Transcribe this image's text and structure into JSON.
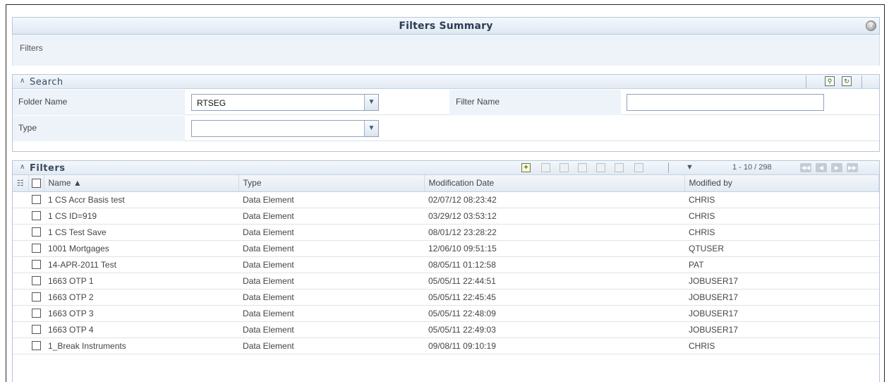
{
  "header": {
    "title": "Filters Summary",
    "help_icon": "help-icon"
  },
  "breadcrumb": {
    "text": "Filters"
  },
  "search": {
    "title": "Search",
    "folder_name_label": "Folder Name",
    "folder_name_value": "RTSEG",
    "filter_name_label": "Filter Name",
    "filter_name_value": "",
    "type_label": "Type",
    "type_value": "",
    "icons": [
      "search-icon",
      "reset-icon"
    ]
  },
  "filters": {
    "title": "Filters",
    "pagination": "1 - 10 / 298",
    "columns": [
      "Name ▲",
      "Type",
      "Modification Date",
      "Modified by"
    ],
    "toolbar_icons": [
      "add-icon",
      "view-icon",
      "edit-icon",
      "save-as-icon",
      "copy-icon",
      "delete-icon",
      "check-dependency-icon",
      "filter-icon"
    ],
    "pager_icons": [
      "first-page-icon",
      "prev-page-icon",
      "next-page-icon",
      "last-page-icon"
    ],
    "rows": [
      {
        "name": "1 CS Accr Basis test",
        "type": "Data Element",
        "date": "02/07/12 08:23:42",
        "by": "CHRIS"
      },
      {
        "name": "1 CS ID=919",
        "type": "Data Element",
        "date": "03/29/12 03:53:12",
        "by": "CHRIS"
      },
      {
        "name": "1 CS Test Save",
        "type": "Data Element",
        "date": "08/01/12 23:28:22",
        "by": "CHRIS"
      },
      {
        "name": "1001 Mortgages",
        "type": "Data Element",
        "date": "12/06/10 09:51:15",
        "by": "QTUSER"
      },
      {
        "name": "14-APR-2011 Test",
        "type": "Data Element",
        "date": "08/05/11 01:12:58",
        "by": "PAT"
      },
      {
        "name": "1663 OTP 1",
        "type": "Data Element",
        "date": "05/05/11 22:44:51",
        "by": "JOBUSER17"
      },
      {
        "name": "1663 OTP 2",
        "type": "Data Element",
        "date": "05/05/11 22:45:45",
        "by": "JOBUSER17"
      },
      {
        "name": "1663 OTP 3",
        "type": "Data Element",
        "date": "05/05/11 22:48:09",
        "by": "JOBUSER17"
      },
      {
        "name": "1663 OTP 4",
        "type": "Data Element",
        "date": "05/05/11 22:49:03",
        "by": "JOBUSER17"
      },
      {
        "name": "1_Break Instruments",
        "type": "Data Element",
        "date": "09/08/11 09:10:19",
        "by": "CHRIS"
      }
    ]
  }
}
